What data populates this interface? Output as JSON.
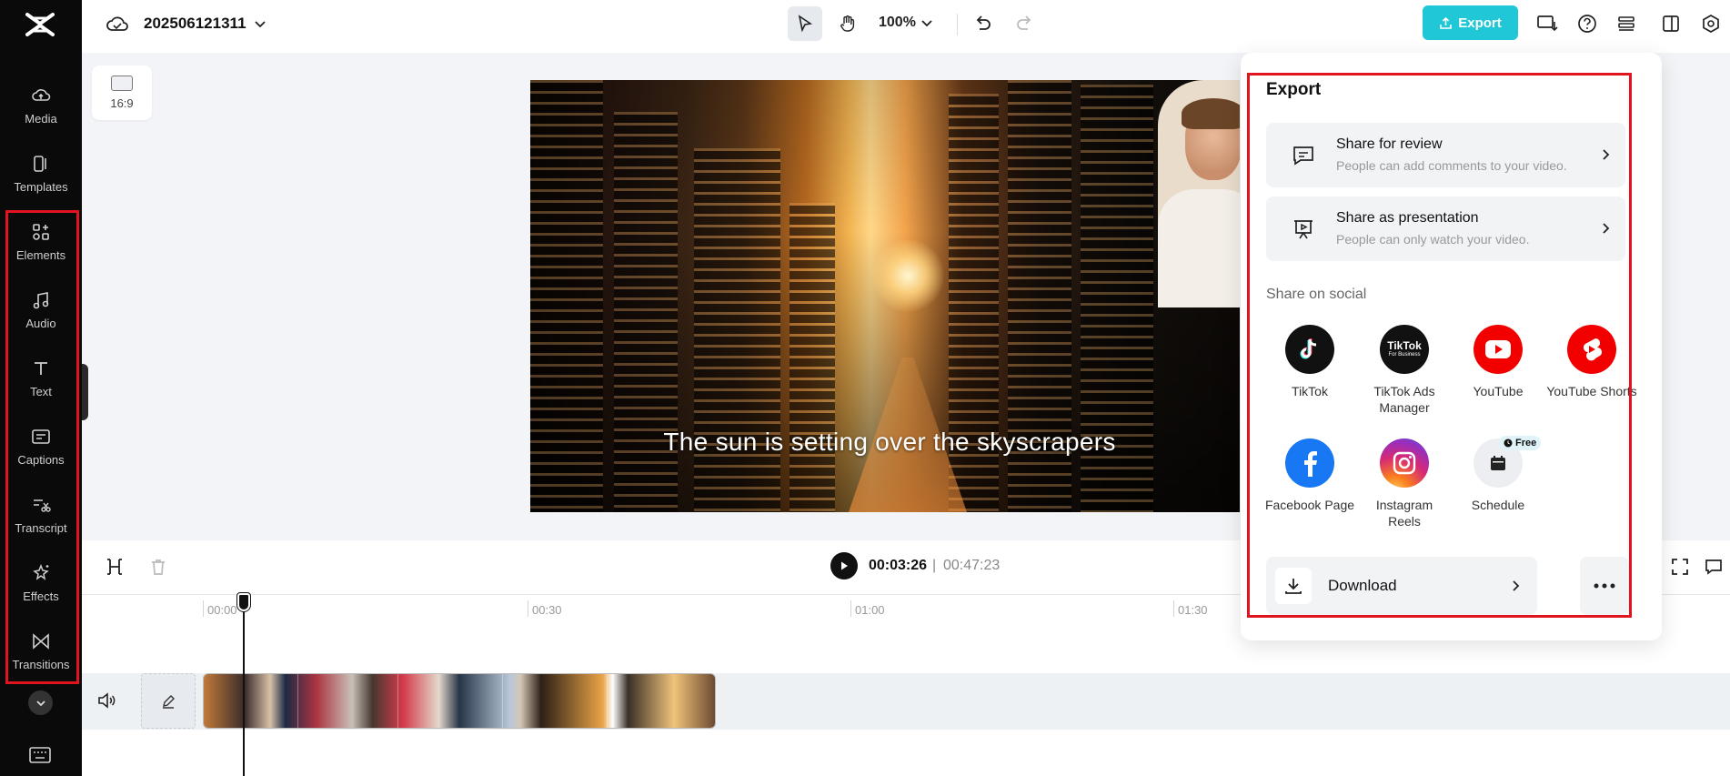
{
  "app": {
    "project_title": "202506121311",
    "zoom_level": "100%",
    "export_label": "Export",
    "accent_color": "#20c7d6",
    "highlight_color": "#e0141e"
  },
  "sidebar": {
    "items": [
      {
        "label": "Media",
        "icon": "media-icon"
      },
      {
        "label": "Templates",
        "icon": "templates-icon"
      },
      {
        "label": "Elements",
        "icon": "elements-icon"
      },
      {
        "label": "Audio",
        "icon": "audio-icon"
      },
      {
        "label": "Text",
        "icon": "text-icon"
      },
      {
        "label": "Captions",
        "icon": "captions-icon"
      },
      {
        "label": "Transcript",
        "icon": "transcript-icon"
      },
      {
        "label": "Effects",
        "icon": "effects-icon"
      },
      {
        "label": "Transitions",
        "icon": "transitions-icon"
      }
    ]
  },
  "canvas": {
    "aspect_ratio": "16:9",
    "caption": "The sun is setting over the skyscrapers"
  },
  "timeline": {
    "current_time": "00:03:26",
    "separator": "|",
    "total_time": "00:47:23",
    "ruler": [
      "00:00",
      "00:30",
      "01:00",
      "01:30"
    ]
  },
  "export_panel": {
    "title": "Export",
    "share_review": {
      "title": "Share for review",
      "subtitle": "People can add comments to your video."
    },
    "share_presentation": {
      "title": "Share as presentation",
      "subtitle": "People can only watch your video."
    },
    "social_heading": "Share on social",
    "social_items": [
      {
        "label": "TikTok",
        "icon": "tiktok-icon"
      },
      {
        "label": "TikTok Ads Manager",
        "icon": "tiktok-ads-icon",
        "logo_text": "TikTok",
        "logo_subtext": "For Business"
      },
      {
        "label": "YouTube",
        "icon": "youtube-icon"
      },
      {
        "label": "YouTube Shorts",
        "icon": "youtube-shorts-icon"
      },
      {
        "label": "Facebook Page",
        "icon": "facebook-icon"
      },
      {
        "label": "Instagram Reels",
        "icon": "instagram-icon"
      },
      {
        "label": "Schedule",
        "icon": "calendar-icon"
      }
    ],
    "schedule_badge": "Free",
    "download_label": "Download"
  }
}
